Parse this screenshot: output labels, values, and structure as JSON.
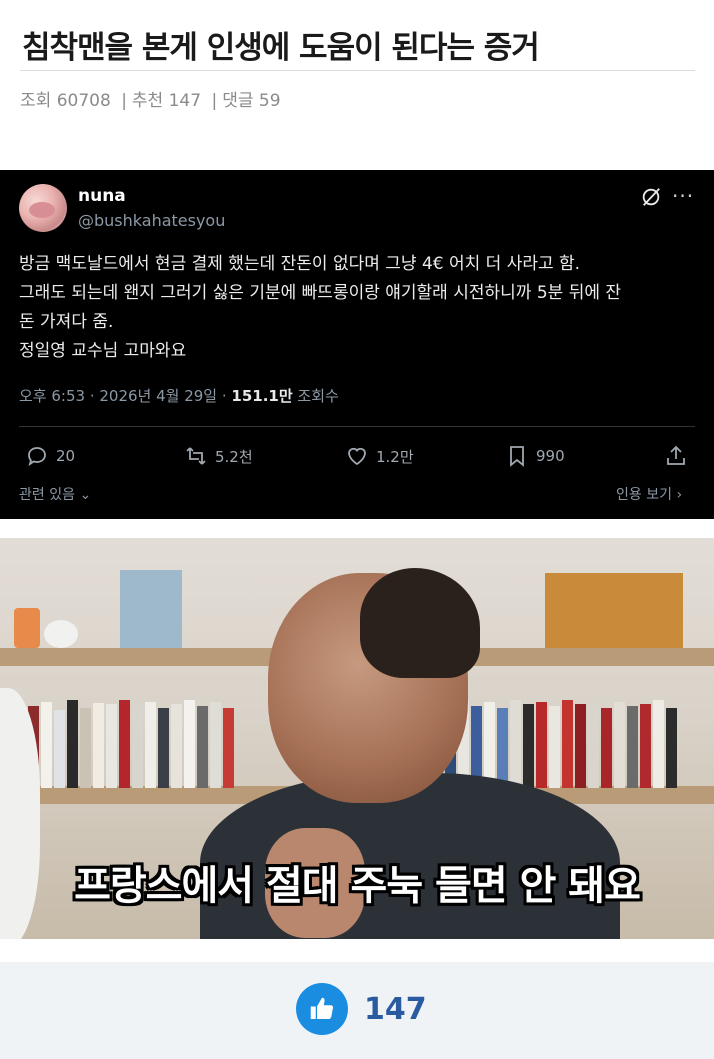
{
  "post": {
    "title": "침착맨을 본게 인생에 도움이 된다는 증거",
    "views_label": "조회",
    "views": "60708",
    "recommend_label": "추천",
    "recommend": "147",
    "comments_label": "댓글",
    "comments": "59",
    "separator": "|"
  },
  "tweet": {
    "author": "nuna",
    "handle": "@bushkahatesyou",
    "body_lines": [
      "방금 맥도날드에서 현금 결제 했는데 잔돈이 없다며 그냥 4€ 어치 더 사라고 함.",
      "그래도 되는데 왠지 그러기 싫은 기분에 빠뜨롱이랑 얘기할래 시전하니까 5분 뒤에 잔",
      "돈 가져다 줌.",
      "정일영 교수님 고마와요"
    ],
    "timestamp": "오후 6:53 · 2026년 4월 29일 · ",
    "view_count": "151.1만",
    "view_label": " 조회수",
    "replies": "20",
    "retweets": "5.2천",
    "likes": "1.2만",
    "bookmarks": "990",
    "related": "관련 있음",
    "quote": "인용 보기",
    "more": "···"
  },
  "video": {
    "subtitle": "프랑스에서 절대 주눅 들면 안 돼요"
  },
  "footer": {
    "like_count": "147"
  },
  "colors": {
    "accent": "#1a8de0",
    "tweet_bg": "#000000",
    "footer_bg": "#f0f3f6"
  },
  "icons": [
    "grok-icon",
    "more-icon",
    "reply-icon",
    "retweet-icon",
    "heart-icon",
    "bookmark-icon",
    "share-icon",
    "thumbs-up-icon"
  ]
}
